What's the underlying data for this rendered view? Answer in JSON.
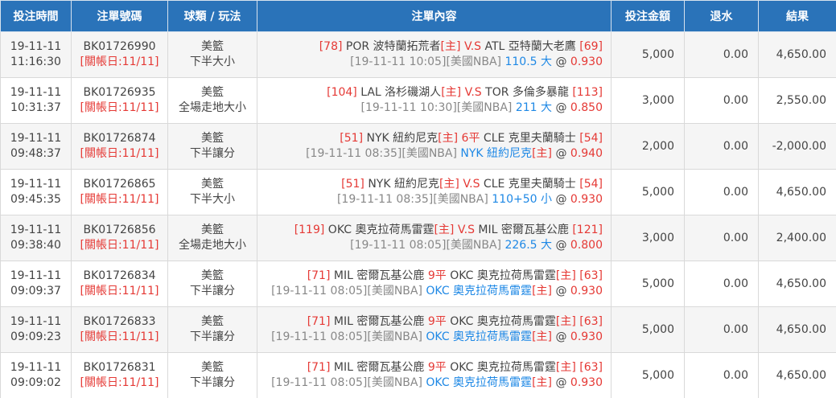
{
  "headers": [
    "投注時間",
    "注單號碼",
    "球類 / 玩法",
    "注單內容",
    "投注金額",
    "退水",
    "結果"
  ],
  "rows": [
    {
      "date": "19-11-11",
      "time": "11:16:30",
      "ticket": "BK01726990",
      "settle": "[關帳日:11/11]",
      "sport": "美籃",
      "bet_type": "下半大小",
      "home_no": "[78]",
      "home": "POR 波特蘭拓荒者",
      "home_tag": "[主]",
      "vs": "V.S",
      "away": "ATL 亞特蘭大老鷹",
      "away_no": "[69]",
      "match_time": "[19-11-11 10:05]",
      "league": "[美國NBA]",
      "pick": "110.5 大",
      "pick_tag": "",
      "at": "@",
      "odds": "0.930",
      "amount": "5,000",
      "rebate": "0.00",
      "result": "4,650.00",
      "outcome": "win"
    },
    {
      "date": "19-11-11",
      "time": "10:31:37",
      "ticket": "BK01726935",
      "settle": "[關帳日:11/11]",
      "sport": "美籃",
      "bet_type": "全場走地大小",
      "home_no": "[104]",
      "home": "LAL 洛杉磯湖人",
      "home_tag": "[主]",
      "vs": "V.S",
      "away": "TOR 多倫多暴龍",
      "away_no": "[113]",
      "match_time": "[19-11-11 10:30]",
      "league": "[美國NBA]",
      "pick": "211 大",
      "pick_tag": "",
      "at": "@",
      "odds": "0.850",
      "amount": "3,000",
      "rebate": "0.00",
      "result": "2,550.00",
      "outcome": "win"
    },
    {
      "date": "19-11-11",
      "time": "09:48:37",
      "ticket": "BK01726874",
      "settle": "[關帳日:11/11]",
      "sport": "美籃",
      "bet_type": "下半讓分",
      "home_no": "[51]",
      "home": "NYK 紐約尼克",
      "home_tag": "[主]",
      "vs": "6平",
      "away": "CLE 克里夫蘭騎士",
      "away_no": "[54]",
      "match_time": "[19-11-11 08:35]",
      "league": "[美國NBA]",
      "pick": "NYK 紐約尼克",
      "pick_tag": "[主]",
      "at": "@",
      "odds": "0.940",
      "amount": "2,000",
      "rebate": "0.00",
      "result": "-2,000.00",
      "outcome": "lose"
    },
    {
      "date": "19-11-11",
      "time": "09:45:35",
      "ticket": "BK01726865",
      "settle": "[關帳日:11/11]",
      "sport": "美籃",
      "bet_type": "下半大小",
      "home_no": "[51]",
      "home": "NYK 紐約尼克",
      "home_tag": "[主]",
      "vs": "V.S",
      "away": "CLE 克里夫蘭騎士",
      "away_no": "[54]",
      "match_time": "[19-11-11 08:35]",
      "league": "[美國NBA]",
      "pick": "110+50 小",
      "pick_tag": "",
      "at": "@",
      "odds": "0.930",
      "amount": "5,000",
      "rebate": "0.00",
      "result": "4,650.00",
      "outcome": "win"
    },
    {
      "date": "19-11-11",
      "time": "09:38:40",
      "ticket": "BK01726856",
      "settle": "[關帳日:11/11]",
      "sport": "美籃",
      "bet_type": "全場走地大小",
      "home_no": "[119]",
      "home": "OKC 奧克拉荷馬雷霆",
      "home_tag": "[主]",
      "vs": "V.S",
      "away": "MIL 密爾瓦基公鹿",
      "away_no": "[121]",
      "match_time": "[19-11-11 08:05]",
      "league": "[美國NBA]",
      "pick": "226.5 大",
      "pick_tag": "",
      "at": "@",
      "odds": "0.800",
      "amount": "3,000",
      "rebate": "0.00",
      "result": "2,400.00",
      "outcome": "win"
    },
    {
      "date": "19-11-11",
      "time": "09:09:37",
      "ticket": "BK01726834",
      "settle": "[關帳日:11/11]",
      "sport": "美籃",
      "bet_type": "下半讓分",
      "home_no": "[71]",
      "home": "MIL 密爾瓦基公鹿",
      "home_tag": "",
      "vs": "9平",
      "away": "OKC 奧克拉荷馬雷霆",
      "away_no": "[63]",
      "away_tag": "[主]",
      "match_time": "[19-11-11 08:05]",
      "league": "[美國NBA]",
      "pick": "OKC 奧克拉荷馬雷霆",
      "pick_tag": "[主]",
      "at": "@",
      "odds": "0.930",
      "amount": "5,000",
      "rebate": "0.00",
      "result": "4,650.00",
      "outcome": "win"
    },
    {
      "date": "19-11-11",
      "time": "09:09:23",
      "ticket": "BK01726833",
      "settle": "[關帳日:11/11]",
      "sport": "美籃",
      "bet_type": "下半讓分",
      "home_no": "[71]",
      "home": "MIL 密爾瓦基公鹿",
      "home_tag": "",
      "vs": "9平",
      "away": "OKC 奧克拉荷馬雷霆",
      "away_no": "[63]",
      "away_tag": "[主]",
      "match_time": "[19-11-11 08:05]",
      "league": "[美國NBA]",
      "pick": "OKC 奧克拉荷馬雷霆",
      "pick_tag": "[主]",
      "at": "@",
      "odds": "0.930",
      "amount": "5,000",
      "rebate": "0.00",
      "result": "4,650.00",
      "outcome": "win"
    },
    {
      "date": "19-11-11",
      "time": "09:09:02",
      "ticket": "BK01726831",
      "settle": "[關帳日:11/11]",
      "sport": "美籃",
      "bet_type": "下半讓分",
      "home_no": "[71]",
      "home": "MIL 密爾瓦基公鹿",
      "home_tag": "",
      "vs": "9平",
      "away": "OKC 奧克拉荷馬雷霆",
      "away_no": "[63]",
      "away_tag": "[主]",
      "match_time": "[19-11-11 08:05]",
      "league": "[美國NBA]",
      "pick": "OKC 奧克拉荷馬雷霆",
      "pick_tag": "[主]",
      "at": "@",
      "odds": "0.930",
      "amount": "5,000",
      "rebate": "0.00",
      "result": "4,650.00",
      "outcome": "win"
    }
  ],
  "colors": {
    "header_bg": "#2a73b9",
    "win": "#43a047",
    "lose": "#e53935",
    "accent_red": "#e53935",
    "accent_blue": "#1e88e5"
  }
}
